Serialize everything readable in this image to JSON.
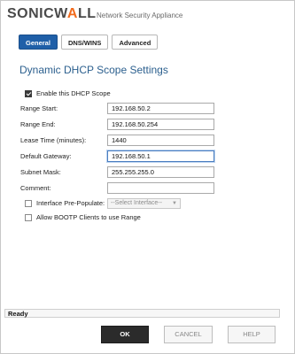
{
  "header": {
    "logo_main": "SONICW",
    "logo_accent": "A",
    "logo_end": "LL",
    "title": "Network Security Appliance"
  },
  "tabs": [
    {
      "label": "General",
      "active": true
    },
    {
      "label": "DNS/WINS",
      "active": false
    },
    {
      "label": "Advanced",
      "active": false
    }
  ],
  "section_title": "Dynamic DHCP Scope Settings",
  "enable_scope": {
    "label": "Enable this DHCP Scope",
    "checked": true
  },
  "fields": {
    "range_start": {
      "label": "Range Start:",
      "value": "192.168.50.2"
    },
    "range_end": {
      "label": "Range End:",
      "value": "192.168.50.254"
    },
    "lease_time": {
      "label": "Lease Time (minutes):",
      "value": "1440"
    },
    "default_gateway": {
      "label": "Default Gateway:",
      "value": "192.168.50.1"
    },
    "subnet_mask": {
      "label": "Subnet Mask:",
      "value": "255.255.255.0"
    },
    "comment": {
      "label": "Comment:",
      "value": ""
    }
  },
  "interface_prepopulate": {
    "label": "Interface Pre-Populate:",
    "checked": false,
    "select_text": "--Select Interface--"
  },
  "allow_bootp": {
    "label": "Allow BOOTP Clients to use Range",
    "checked": false
  },
  "status": "Ready",
  "buttons": {
    "ok": "OK",
    "cancel": "CANCEL",
    "help": "HELP"
  },
  "colors": {
    "accent": "#1f5fa8",
    "title": "#2b5f8e",
    "logo_accent": "#f26b1d"
  }
}
